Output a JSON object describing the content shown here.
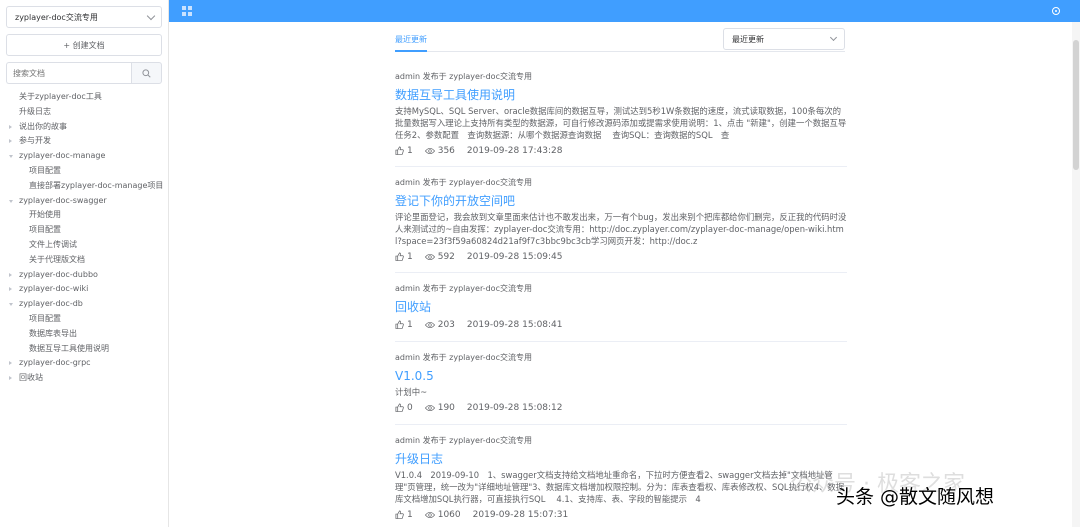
{
  "sidebar": {
    "space_select": "zyplayer-doc交流专用",
    "create_button": "+ 创建文档",
    "search_placeholder": "搜索文档",
    "tree": [
      {
        "label": "关于zyplayer-doc工具",
        "level": 1,
        "arrow": "none"
      },
      {
        "label": "升级日志",
        "level": 1,
        "arrow": "none"
      },
      {
        "label": "说出你的故事",
        "level": 1,
        "arrow": "closed"
      },
      {
        "label": "参与开发",
        "level": 1,
        "arrow": "closed"
      },
      {
        "label": "zyplayer-doc-manage",
        "level": 1,
        "arrow": "open"
      },
      {
        "label": "项目配置",
        "level": 2,
        "arrow": "none"
      },
      {
        "label": "直接部署zyplayer-doc-manage项目",
        "level": 2,
        "arrow": "none"
      },
      {
        "label": "zyplayer-doc-swagger",
        "level": 1,
        "arrow": "open"
      },
      {
        "label": "开始使用",
        "level": 2,
        "arrow": "none"
      },
      {
        "label": "项目配置",
        "level": 2,
        "arrow": "none"
      },
      {
        "label": "文件上传调试",
        "level": 2,
        "arrow": "none"
      },
      {
        "label": "关于代理版文档",
        "level": 2,
        "arrow": "none"
      },
      {
        "label": "zyplayer-doc-dubbo",
        "level": 1,
        "arrow": "closed"
      },
      {
        "label": "zyplayer-doc-wiki",
        "level": 1,
        "arrow": "closed"
      },
      {
        "label": "zyplayer-doc-db",
        "level": 1,
        "arrow": "open"
      },
      {
        "label": "项目配置",
        "level": 2,
        "arrow": "none"
      },
      {
        "label": "数据库表导出",
        "level": 2,
        "arrow": "none"
      },
      {
        "label": "数据互导工具使用说明",
        "level": 2,
        "arrow": "none"
      },
      {
        "label": "zyplayer-doc-grpc",
        "level": 1,
        "arrow": "closed"
      },
      {
        "label": "回收站",
        "level": 1,
        "arrow": "closed"
      }
    ]
  },
  "main": {
    "tab_active": "最近更新",
    "sort_select": "最近更新",
    "articles": [
      {
        "meta": "admin 发布于 zyplayer-doc交流专用",
        "title": "数据互导工具使用说明",
        "preview": "支持MySQL、SQL Server、oracle数据库间的数据互导，测试达到5秒1W条数据的速度，流式读取数据，100条每次的批量数据写入理论上支持所有类型的数据源，可自行修改源码添加或提需求使用说明：1、点击 \"新建\"，创建一个数据互导任务2、参数配置　查询数据源：从哪个数据源查询数据　 查询SQL：查询数据的SQL　查",
        "likes": "1",
        "views": "356",
        "time": "2019-09-28 17:43:28"
      },
      {
        "meta": "admin 发布于 zyplayer-doc交流专用",
        "title": "登记下你的开放空间吧",
        "preview": "评论里面登记，我会放到文章里面来估计也不敢发出来，万一有个bug，发出来别个把库都给你们删完，反正我的代码时没人来测试过的~自由发挥：zyplayer-doc交流专用：http://doc.zyplayer.com/zyplayer-doc-manage/open-wiki.html?space=23f3f59a60824d21af9f7c3bbc9bc3cb学习网页开发：http://doc.z",
        "likes": "1",
        "views": "592",
        "time": "2019-09-28 15:09:45"
      },
      {
        "meta": "admin 发布于 zyplayer-doc交流专用",
        "title": "回收站",
        "preview": "",
        "likes": "1",
        "views": "203",
        "time": "2019-09-28 15:08:41"
      },
      {
        "meta": "admin 发布于 zyplayer-doc交流专用",
        "title": "V1.0.5",
        "preview": "计划中~",
        "likes": "0",
        "views": "190",
        "time": "2019-09-28 15:08:12"
      },
      {
        "meta": "admin 发布于 zyplayer-doc交流专用",
        "title": "升级日志",
        "preview": "V1.0.4　2019-09-10　1、swagger文档支持给文档地址重命名，下拉时方便查看2、swagger文档去掉\"文档地址管理\"页管理，统一改为\"详细地址管理\"3、数据库文档增加权限控制。分为：库表查看权、库表修改权、SQL执行权4、数据库文档增加SQL执行器，可直接执行SQL　 4.1、支持库、表、字段的智能提示　4",
        "likes": "1",
        "views": "1060",
        "time": "2019-09-28 15:07:31"
      }
    ]
  },
  "watermark": {
    "faint": "公众号 · 极客之家",
    "main": "头条 @散文随风想"
  },
  "colors": {
    "primary": "#409eff",
    "text": "#606266",
    "border": "#dcdfe6"
  }
}
